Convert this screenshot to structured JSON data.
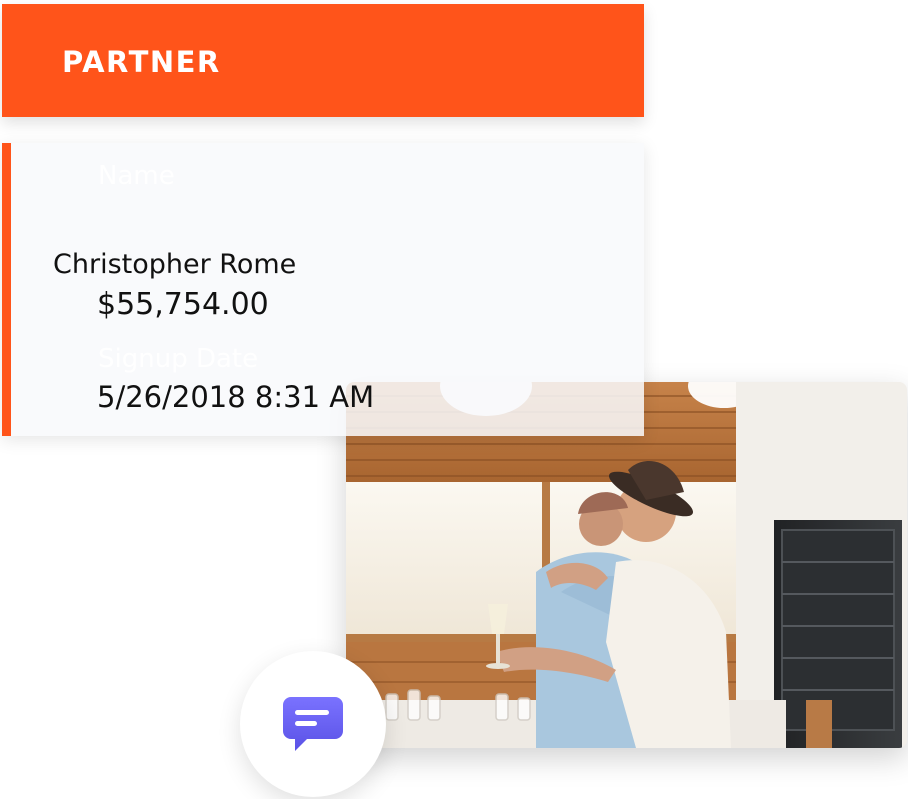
{
  "header": {
    "title": "PARTNER",
    "color": "#ff541a"
  },
  "card": {
    "name_label": "Name",
    "name": "Christopher Rome",
    "amount": "$55,754.00",
    "signup_label": "Signup Date",
    "signup_date": "5/26/2018 8:31 AM",
    "accent_color": "#ff541a"
  },
  "photo": {
    "description_icon": "photo-two-people-hugging"
  },
  "chat": {
    "icon": "chat-bubble-icon",
    "color": "#6b63f5"
  }
}
